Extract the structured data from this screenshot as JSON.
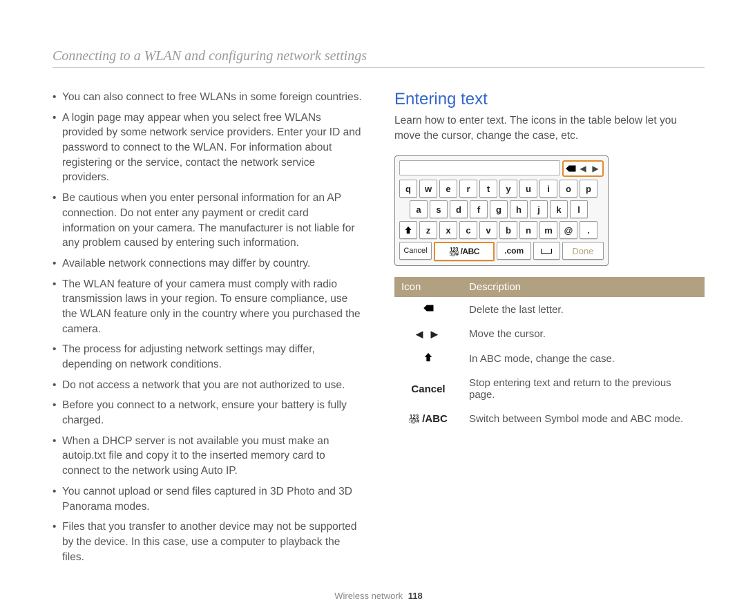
{
  "page_title": "Connecting to a WLAN and configuring network settings",
  "left_bullets": [
    "You can also connect to free WLANs in some foreign countries.",
    "A login page may appear when you select free WLANs provided by some network service providers. Enter your ID and password to connect to the WLAN. For information about registering or the service, contact the network service providers.",
    "Be cautious when you enter personal information for an AP connection. Do not enter any payment or credit card information on your camera. The manufacturer is not liable for any problem caused by entering such information.",
    "Available network connections may differ by country.",
    "The WLAN feature of your camera must comply with radio transmission laws in your region. To ensure compliance, use the WLAN feature only in the country where you purchased the camera.",
    "The process for adjusting network settings may differ, depending on network conditions.",
    "Do not access a network that you are not authorized to use.",
    "Before you connect to a network, ensure your battery is fully charged.",
    "When a DHCP server is not available you must make an autoip.txt file and copy it to the inserted memory card to connect to the network using Auto IP.",
    "You cannot upload or send files captured in 3D Photo and 3D Panorama modes.",
    "Files that you transfer to another device may not be supported by the device. In this case, use a computer to playback the files."
  ],
  "right": {
    "heading": "Entering text",
    "intro": "Learn how to enter text. The icons in the table below let you move the cursor, change the case, etc."
  },
  "keyboard": {
    "rows": [
      [
        "q",
        "w",
        "e",
        "r",
        "t",
        "y",
        "u",
        "i",
        "o",
        "p"
      ],
      [
        "a",
        "s",
        "d",
        "f",
        "g",
        "h",
        "j",
        "k",
        "l"
      ],
      [
        "z",
        "x",
        "c",
        "v",
        "b",
        "n",
        "m",
        "@",
        "."
      ]
    ],
    "bottom": {
      "cancel": "Cancel",
      "sym_abc_sup": "123",
      "sym_abc_sub": "!@#",
      "sym_abc_main": " /ABC",
      "com": ".com",
      "done": "Done"
    }
  },
  "icon_table": {
    "headers": [
      "Icon",
      "Description"
    ],
    "rows": [
      {
        "icon": "back",
        "desc": "Delete the last letter."
      },
      {
        "icon": "arrows",
        "desc": "Move the cursor."
      },
      {
        "icon": "shift",
        "desc": "In ABC mode, change the case."
      },
      {
        "icon": "cancel",
        "label": "Cancel",
        "desc": "Stop entering text and return to the previous page."
      },
      {
        "icon": "symabc",
        "desc": "Switch between Symbol mode and ABC mode."
      }
    ]
  },
  "footer_section": "Wireless network",
  "footer_page": "118"
}
